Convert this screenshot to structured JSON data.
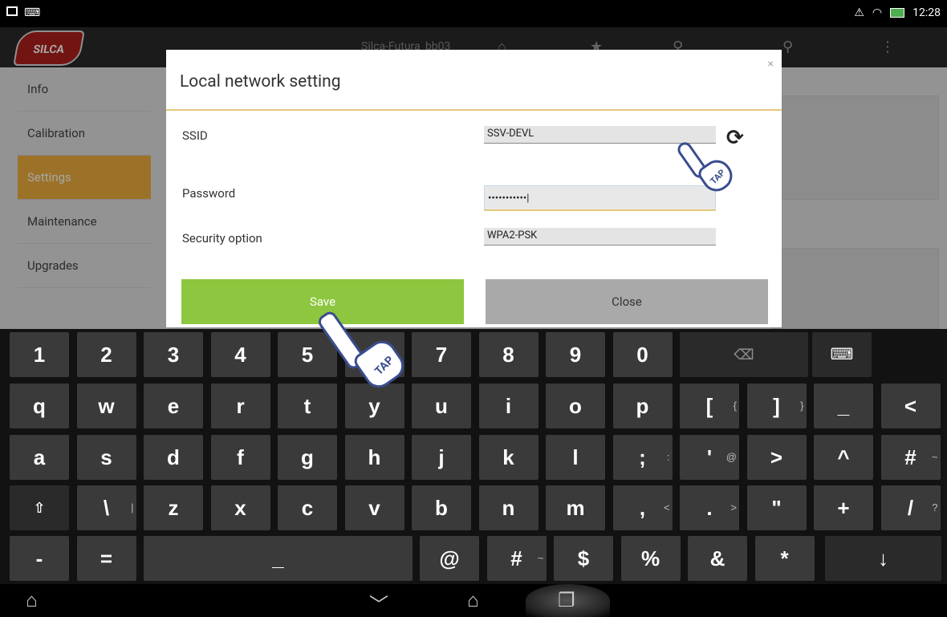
{
  "statusbar": {
    "time": "12:28"
  },
  "appbar": {
    "logo_text": "SILCA",
    "title": "Silca-Futura_bb03"
  },
  "nav": {
    "items": [
      {
        "label": "Info",
        "active": false
      },
      {
        "label": "Calibration",
        "active": false
      },
      {
        "label": "Settings",
        "active": true
      },
      {
        "label": "Maintenance",
        "active": false
      },
      {
        "label": "Upgrades",
        "active": false
      }
    ]
  },
  "dialog": {
    "title": "Local network setting",
    "close_glyph": "×",
    "ssid": {
      "label": "SSID",
      "value": "SSV-DEVL"
    },
    "password": {
      "label": "Password",
      "value": "•••••••••••|"
    },
    "security": {
      "label": "Security option",
      "value": "WPA2-PSK"
    },
    "save_label": "Save",
    "close_label": "Close",
    "tap_label": "TAP"
  },
  "keyboard": {
    "rows": [
      [
        "1",
        "2",
        "3",
        "4",
        "5",
        "6",
        "7",
        "8",
        "9",
        "0"
      ],
      [
        "q",
        "w",
        "e",
        "r",
        "t",
        "y",
        "u",
        "i",
        "o",
        "p",
        "[",
        "]",
        "_",
        "<"
      ],
      [
        "a",
        "s",
        "d",
        "f",
        "g",
        "h",
        "j",
        "k",
        "l",
        ";",
        "'",
        ">",
        "^",
        "#"
      ],
      [
        "\\",
        "z",
        "x",
        "c",
        "v",
        "b",
        "n",
        "m",
        ",",
        ".",
        "\"",
        "+",
        "/"
      ],
      [
        "-",
        "=",
        "_",
        "@",
        "#",
        "$",
        "%",
        "&",
        "*",
        "↓"
      ]
    ],
    "alts": {
      "[": "{",
      "]": "}",
      ";": ":",
      "'": "@",
      "#": "~",
      "\\": "|",
      ",": "<",
      ".": ">",
      "/": "?"
    }
  }
}
